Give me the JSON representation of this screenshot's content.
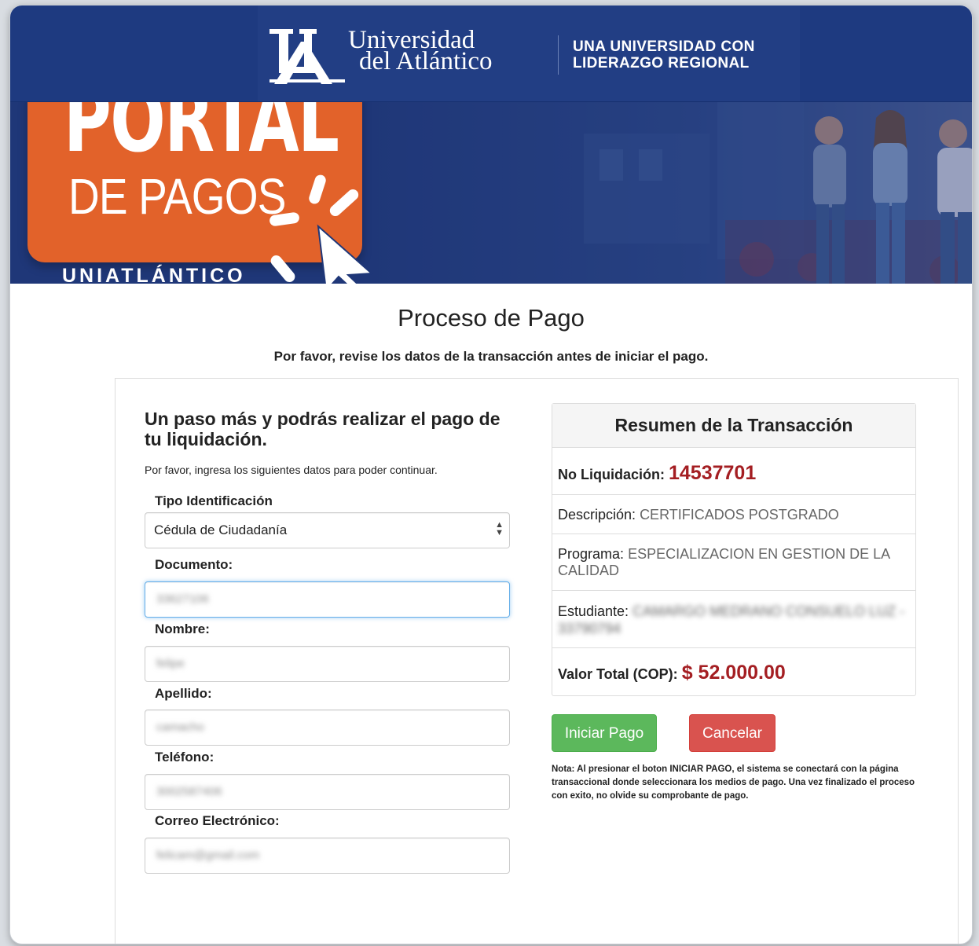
{
  "header": {
    "university_line1": "Universidad",
    "university_line2": "del Atlántico",
    "slogan_line1": "UNA UNIVERSIDAD CON",
    "slogan_line2": "LIDERAZGO REGIONAL",
    "brand_color": "#1e3a80",
    "logo_icon": "ua-logo-icon"
  },
  "banner": {
    "portal": "PORTAL",
    "de_pagos": "DE PAGOS",
    "uniatlantico": "UNIATLÁNTICO",
    "card_color": "#e2622a",
    "cursor_icon": "pointer-cursor-icon"
  },
  "page": {
    "title": "Proceso de Pago",
    "subtitle": "Por favor, revise los datos de la transacción antes de iniciar el pago."
  },
  "form": {
    "heading": "Un paso más y podrás realizar el pago de tu liquidación.",
    "hint": "Por favor, ingresa los siguientes datos para poder continuar.",
    "tipo_label": "Tipo Identificación",
    "tipo_value": "Cédula de Ciudadanía",
    "documento_label": "Documento:",
    "documento_value": "33627106",
    "nombre_label": "Nombre:",
    "nombre_value": "felipe",
    "apellido_label": "Apellido:",
    "apellido_value": "camacho",
    "telefono_label": "Teléfono:",
    "telefono_value": "3002587406",
    "correo_label": "Correo Electrónico:",
    "correo_value": "felicam@gmail.com"
  },
  "summary": {
    "title": "Resumen de la Transacción",
    "liquidacion_label": "No Liquidación:",
    "liquidacion_value": "14537701",
    "descripcion_label": "Descripción:",
    "descripcion_value": "CERTIFICADOS POSTGRADO",
    "programa_label": "Programa:",
    "programa_value": "ESPECIALIZACION EN GESTION DE LA CALIDAD",
    "estudiante_label": "Estudiante:",
    "estudiante_value": "CAMARGO MEDRANO CONSUELO LUZ - 33790794",
    "total_label": "Valor Total (COP):",
    "total_value": "$ 52.000.00",
    "highlight_color": "#a41e22"
  },
  "actions": {
    "pay_label": "Iniciar Pago",
    "cancel_label": "Cancelar",
    "pay_color": "#5cb85c",
    "cancel_color": "#d9534f",
    "note": "Nota: Al presionar el boton INICIAR PAGO, el sistema se conectará con la página transaccional donde seleccionara los medios de pago. Una vez finalizado el proceso con exito, no olvide su comprobante de pago."
  }
}
